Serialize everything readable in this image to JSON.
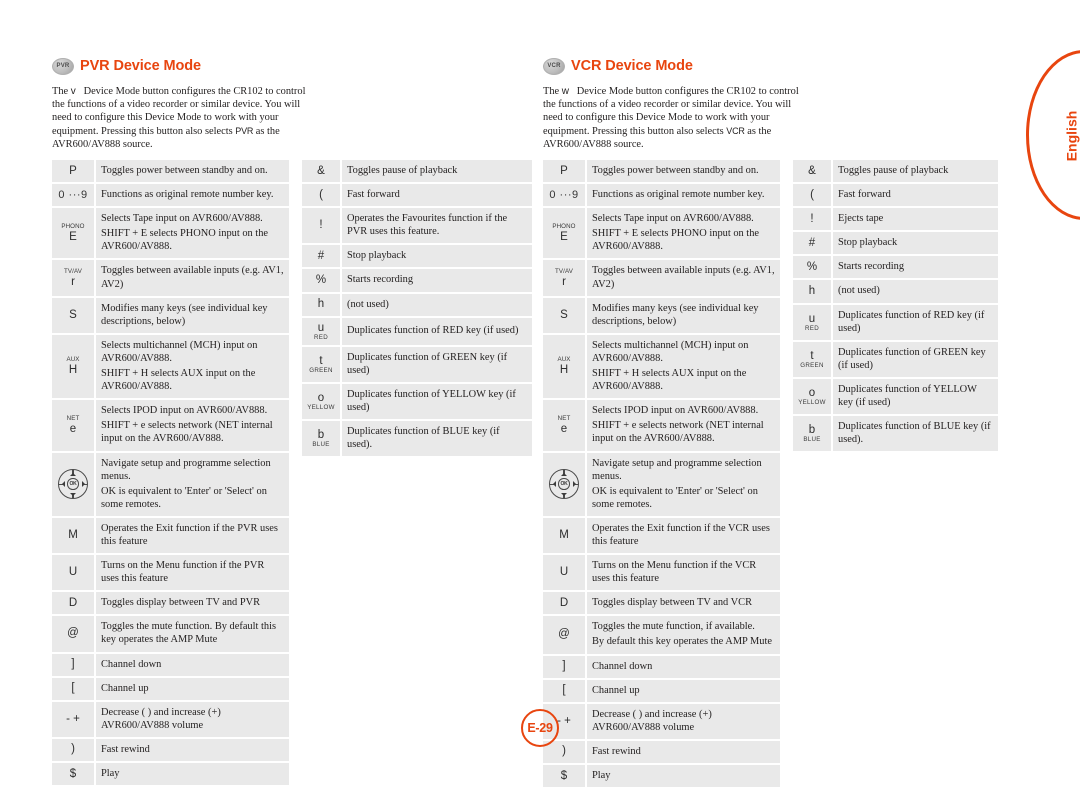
{
  "page": {
    "badge": "E-29",
    "side_tab": "English",
    "accent_color": "#e8450f",
    "cell_bg": "#e9e9e9",
    "text_color": "#221f1f"
  },
  "pvr": {
    "chip_label": "PVR",
    "title": "PVR Device Mode",
    "intro_pre": "The",
    "intro_key": "v",
    "intro_mid": "Device Mode button configures the CR102 to control the functions of a video recorder or similar device. You will need to configure this Device Mode to work with your equipment. Pressing this button also selects",
    "intro_key2": "PVR",
    "intro_post": "as the AVR600/AV888 source.",
    "table_a": [
      {
        "key": "P",
        "desc": [
          "Toggles power between standby and on."
        ]
      },
      {
        "key": "0  ···9",
        "key_type": "range",
        "desc": [
          "Functions as original remote number key."
        ]
      },
      {
        "key": "E",
        "key_sub": "PHONO",
        "desc": [
          "Selects Tape input on AVR600/AV888.",
          "SHIFT + E   selects PHONO input on the AVR600/AV888."
        ]
      },
      {
        "key": "r",
        "key_sub": "TV/AV",
        "desc": [
          "Toggles between available inputs (e.g. AV1, AV2)"
        ]
      },
      {
        "key": "S",
        "desc": [
          "Modifies many keys (see individual key descriptions, below)"
        ]
      },
      {
        "key": "H",
        "key_sub": "AUX",
        "desc": [
          "Selects multichannel (MCH) input on AVR600/AV888.",
          "SHIFT + H   selects AUX input on the AVR600/AV888."
        ]
      },
      {
        "key": "e",
        "key_sub": "NET",
        "desc": [
          "Selects IPOD input on AVR600/AV888.",
          "SHIFT + e   selects network (NET  internal input on the AVR600/AV888."
        ]
      },
      {
        "key": "dpad-icon",
        "key_type": "dpad",
        "desc": [
          "Navigate setup and programme selection menus.",
          "OK is equivalent to 'Enter' or 'Select' on some remotes."
        ]
      },
      {
        "key": "M",
        "desc": [
          "Operates the Exit function if the PVR uses this feature"
        ]
      },
      {
        "key": "U",
        "desc": [
          "Turns on the Menu function if the PVR uses this feature"
        ]
      },
      {
        "key": "D",
        "desc": [
          "Toggles display between TV and PVR"
        ]
      },
      {
        "key": "@",
        "desc": [
          "Toggles the mute function. By default this key operates the AMP Mute"
        ]
      },
      {
        "key": "]",
        "desc": [
          "Channel down"
        ]
      },
      {
        "key": "[",
        "desc": [
          "Channel up"
        ]
      },
      {
        "key": "- +",
        "desc": [
          "Decrease ( ) and increase (+) AVR600/AV888 volume"
        ]
      },
      {
        "key": ")",
        "desc": [
          "Fast rewind"
        ]
      },
      {
        "key": "$",
        "desc": [
          "Play"
        ]
      }
    ],
    "table_b": [
      {
        "key": "&",
        "desc": [
          "Toggles pause of playback"
        ]
      },
      {
        "key": "(",
        "desc": [
          "Fast forward"
        ]
      },
      {
        "key": "!",
        "desc": [
          "Operates the Favourites function if the PVR uses this feature."
        ]
      },
      {
        "key": "#",
        "desc": [
          "Stop playback"
        ]
      },
      {
        "key": "%",
        "desc": [
          "Starts recording"
        ]
      },
      {
        "key": "h",
        "desc": [
          "(not used)"
        ]
      },
      {
        "key": "u",
        "key_below": "RED",
        "desc": [
          "Duplicates function of RED key (if used)"
        ]
      },
      {
        "key": "t",
        "key_below": "GREEN",
        "desc": [
          "Duplicates function of GREEN key (if used)"
        ]
      },
      {
        "key": "o",
        "key_below": "YELLOW",
        "desc": [
          "Duplicates function of YELLOW key (if used)"
        ]
      },
      {
        "key": "b",
        "key_below": "BLUE",
        "desc": [
          "Duplicates function of BLUE key (if used)."
        ]
      }
    ]
  },
  "vcr": {
    "chip_label": "VCR",
    "title": "VCR Device Mode",
    "intro_pre": "The",
    "intro_key": "w",
    "intro_mid": "Device Mode button configures the CR102 to control the functions of a video recorder or similar device. You will need to configure this Device Mode to work with your equipment. Pressing this button also selects",
    "intro_key2": "VCR",
    "intro_post": "as the AVR600/AV888 source.",
    "table_a": [
      {
        "key": "P",
        "desc": [
          "Toggles power between standby and on."
        ]
      },
      {
        "key": "0  ···9",
        "key_type": "range",
        "desc": [
          "Functions as original remote number key."
        ]
      },
      {
        "key": "E",
        "key_sub": "PHONO",
        "desc": [
          "Selects Tape input on AVR600/AV888.",
          "SHIFT + E   selects PHONO input on the AVR600/AV888."
        ]
      },
      {
        "key": "r",
        "key_sub": "TV/AV",
        "desc": [
          "Toggles between available inputs (e.g. AV1, AV2)"
        ]
      },
      {
        "key": "S",
        "desc": [
          "Modifies many keys (see individual key descriptions, below)"
        ]
      },
      {
        "key": "H",
        "key_sub": "AUX",
        "desc": [
          "Selects multichannel (MCH) input on AVR600/AV888.",
          "SHIFT + H   selects AUX input on the AVR600/AV888."
        ]
      },
      {
        "key": "e",
        "key_sub": "NET",
        "desc": [
          "Selects IPOD input on AVR600/AV888.",
          "SHIFT + e   selects network (NET  internal input on the AVR600/AV888."
        ]
      },
      {
        "key": "dpad-icon",
        "key_type": "dpad",
        "desc": [
          "Navigate setup and programme selection menus.",
          "OK is equivalent to 'Enter' or 'Select' on some remotes."
        ]
      },
      {
        "key": "M",
        "desc": [
          "Operates the Exit function if the VCR uses this feature"
        ]
      },
      {
        "key": "U",
        "desc": [
          "Turns on the Menu function if the VCR uses this feature"
        ]
      },
      {
        "key": "D",
        "desc": [
          "Toggles display between TV and VCR"
        ]
      },
      {
        "key": "@",
        "desc": [
          "Toggles the mute function, if available.",
          "By default this key operates the AMP Mute"
        ]
      },
      {
        "key": "]",
        "desc": [
          "Channel down"
        ]
      },
      {
        "key": "[",
        "desc": [
          "Channel up"
        ]
      },
      {
        "key": "- +",
        "desc": [
          "Decrease ( ) and increase (+) AVR600/AV888 volume"
        ]
      },
      {
        "key": ")",
        "desc": [
          "Fast rewind"
        ]
      },
      {
        "key": "$",
        "desc": [
          "Play"
        ]
      }
    ],
    "table_b": [
      {
        "key": "&",
        "desc": [
          "Toggles pause of playback"
        ]
      },
      {
        "key": "(",
        "desc": [
          "Fast forward"
        ]
      },
      {
        "key": "!",
        "desc": [
          "Ejects tape"
        ]
      },
      {
        "key": "#",
        "desc": [
          "Stop playback"
        ]
      },
      {
        "key": "%",
        "desc": [
          "Starts recording"
        ]
      },
      {
        "key": "h",
        "desc": [
          "(not used)"
        ]
      },
      {
        "key": "u",
        "key_below": "RED",
        "desc": [
          "Duplicates function of RED key (if used)"
        ]
      },
      {
        "key": "t",
        "key_below": "GREEN",
        "desc": [
          "Duplicates function of GREEN key (if used)"
        ]
      },
      {
        "key": "o",
        "key_below": "YELLOW",
        "desc": [
          "Duplicates function of YELLOW key (if used)"
        ]
      },
      {
        "key": "b",
        "key_below": "BLUE",
        "desc": [
          "Duplicates function of BLUE key (if used)."
        ]
      }
    ]
  }
}
